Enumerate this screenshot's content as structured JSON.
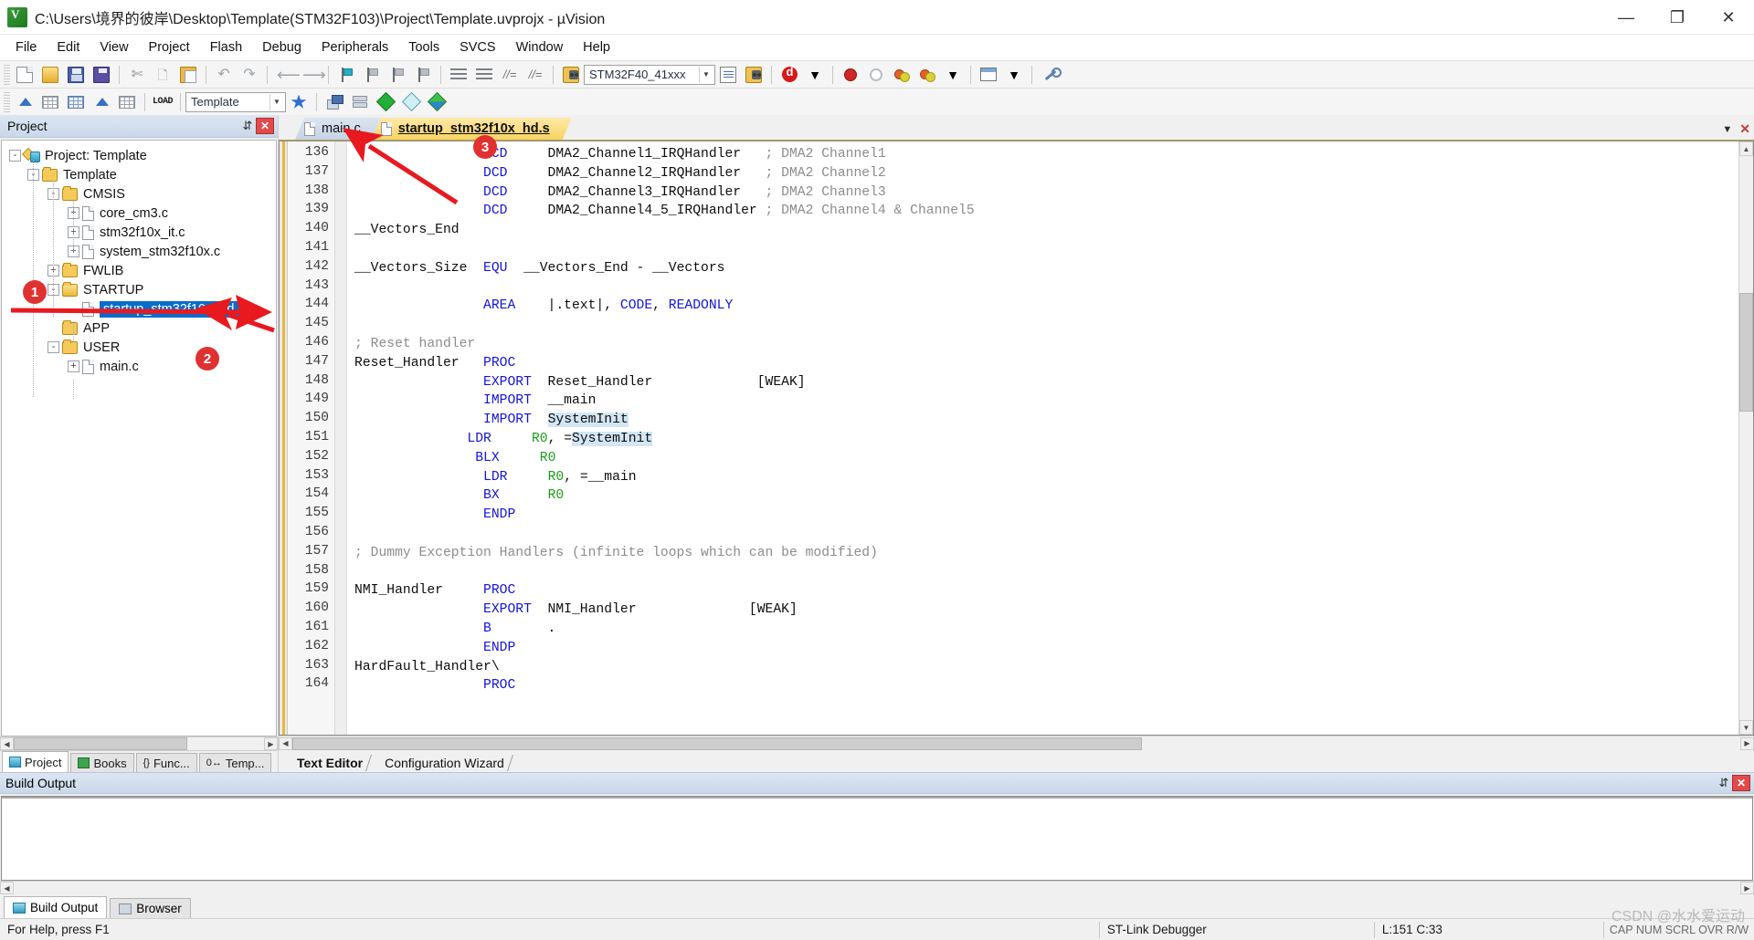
{
  "window": {
    "title": "C:\\Users\\境界的彼岸\\Desktop\\Template(STM32F103)\\Project\\Template.uvprojx - µVision",
    "app_icon": "uvision-icon",
    "minimize": "—",
    "maximize": "❐",
    "close": "✕"
  },
  "menu": [
    {
      "label": "File"
    },
    {
      "label": "Edit"
    },
    {
      "label": "View"
    },
    {
      "label": "Project"
    },
    {
      "label": "Flash"
    },
    {
      "label": "Debug"
    },
    {
      "label": "Peripherals"
    },
    {
      "label": "Tools"
    },
    {
      "label": "SVCS"
    },
    {
      "label": "Window"
    },
    {
      "label": "Help"
    }
  ],
  "toolbar": {
    "target_value": "STM32F40_41xxx",
    "project_value": "Template",
    "load_label": "LOAD"
  },
  "project_panel": {
    "title": "Project",
    "pin_glyph": "⇵",
    "close_glyph": "✕",
    "tree": [
      {
        "label": "Project: Template",
        "level": 0,
        "icon": "project-icon",
        "expander": "-"
      },
      {
        "label": "Template",
        "level": 1,
        "icon": "folder-target-icon",
        "expander": "-"
      },
      {
        "label": "CMSIS",
        "level": 2,
        "icon": "folder-icon",
        "expander": "-"
      },
      {
        "label": "core_cm3.c",
        "level": 3,
        "icon": "file-icon",
        "expander": "+"
      },
      {
        "label": "stm32f10x_it.c",
        "level": 3,
        "icon": "file-icon",
        "expander": "+"
      },
      {
        "label": "system_stm32f10x.c",
        "level": 3,
        "icon": "file-icon",
        "expander": "+"
      },
      {
        "label": "FWLIB",
        "level": 2,
        "icon": "folder-icon",
        "expander": "+"
      },
      {
        "label": "STARTUP",
        "level": 2,
        "icon": "folder-open-icon",
        "expander": "-"
      },
      {
        "label": "startup_stm32f10x_hd.s",
        "level": 3,
        "icon": "file-icon",
        "expander": "",
        "selected": true
      },
      {
        "label": "APP",
        "level": 2,
        "icon": "folder-icon",
        "expander": ""
      },
      {
        "label": "USER",
        "level": 2,
        "icon": "folder-icon",
        "expander": "-"
      },
      {
        "label": "main.c",
        "level": 3,
        "icon": "file-icon",
        "expander": "+"
      }
    ],
    "tabs": [
      {
        "label": "Project",
        "icon": "project-tab-icon",
        "active": true
      },
      {
        "label": "Books",
        "icon": "books-tab-icon",
        "active": false
      },
      {
        "label": "Func...",
        "icon": "functions-tab-icon",
        "active": false
      },
      {
        "label": "Temp...",
        "icon": "templates-tab-icon",
        "active": false
      }
    ]
  },
  "editor": {
    "tabs": [
      {
        "label": "main.c",
        "active": false
      },
      {
        "label": "startup_stm32f10x_hd.s",
        "active": true
      }
    ],
    "first_line": 136,
    "lines": [
      {
        "n": 136,
        "segments": [
          {
            "t": "                ",
            "c": ""
          },
          {
            "t": "DCD",
            "c": "kw"
          },
          {
            "t": "     DMA2_Channel1_IRQHandler   ",
            "c": ""
          },
          {
            "t": "; DMA2 Channel1",
            "c": "cm"
          }
        ]
      },
      {
        "n": 137,
        "segments": [
          {
            "t": "                ",
            "c": ""
          },
          {
            "t": "DCD",
            "c": "kw"
          },
          {
            "t": "     DMA2_Channel2_IRQHandler   ",
            "c": ""
          },
          {
            "t": "; DMA2 Channel2",
            "c": "cm"
          }
        ]
      },
      {
        "n": 138,
        "segments": [
          {
            "t": "                ",
            "c": ""
          },
          {
            "t": "DCD",
            "c": "kw"
          },
          {
            "t": "     DMA2_Channel3_IRQHandler   ",
            "c": ""
          },
          {
            "t": "; DMA2 Channel3",
            "c": "cm"
          }
        ]
      },
      {
        "n": 139,
        "segments": [
          {
            "t": "                ",
            "c": ""
          },
          {
            "t": "DCD",
            "c": "kw"
          },
          {
            "t": "     DMA2_Channel4_5_IRQHandler ",
            "c": ""
          },
          {
            "t": "; DMA2 Channel4 & Channel5",
            "c": "cm"
          }
        ]
      },
      {
        "n": 140,
        "segments": [
          {
            "t": "__Vectors_End",
            "c": ""
          }
        ]
      },
      {
        "n": 141,
        "segments": [
          {
            "t": "",
            "c": ""
          }
        ]
      },
      {
        "n": 142,
        "segments": [
          {
            "t": "__Vectors_Size  ",
            "c": ""
          },
          {
            "t": "EQU",
            "c": "kw"
          },
          {
            "t": "  __Vectors_End - __Vectors",
            "c": ""
          }
        ]
      },
      {
        "n": 143,
        "segments": [
          {
            "t": "",
            "c": ""
          }
        ]
      },
      {
        "n": 144,
        "segments": [
          {
            "t": "                ",
            "c": ""
          },
          {
            "t": "AREA",
            "c": "kw"
          },
          {
            "t": "    |.text|, ",
            "c": ""
          },
          {
            "t": "CODE",
            "c": "kw"
          },
          {
            "t": ", ",
            "c": ""
          },
          {
            "t": "READONLY",
            "c": "kw"
          }
        ]
      },
      {
        "n": 145,
        "segments": [
          {
            "t": "",
            "c": ""
          }
        ]
      },
      {
        "n": 146,
        "segments": [
          {
            "t": "; Reset handler",
            "c": "cm"
          }
        ]
      },
      {
        "n": 147,
        "segments": [
          {
            "t": "Reset_Handler   ",
            "c": ""
          },
          {
            "t": "PROC",
            "c": "kw"
          }
        ]
      },
      {
        "n": 148,
        "segments": [
          {
            "t": "                ",
            "c": ""
          },
          {
            "t": "EXPORT",
            "c": "kw"
          },
          {
            "t": "  Reset_Handler             [WEAK]",
            "c": ""
          }
        ]
      },
      {
        "n": 149,
        "segments": [
          {
            "t": "                ",
            "c": ""
          },
          {
            "t": "IMPORT",
            "c": "kw"
          },
          {
            "t": "  __main",
            "c": ""
          }
        ]
      },
      {
        "n": 150,
        "segments": [
          {
            "t": "                ",
            "c": ""
          },
          {
            "t": "IMPORT",
            "c": "kw"
          },
          {
            "t": "  ",
            "c": ""
          },
          {
            "t": "SystemInit",
            "c": "hl"
          }
        ]
      },
      {
        "n": 151,
        "segments": [
          {
            "t": "              ",
            "c": ""
          },
          {
            "t": "LDR",
            "c": "kw"
          },
          {
            "t": "     ",
            "c": ""
          },
          {
            "t": "R0",
            "c": "reg"
          },
          {
            "t": ", =",
            "c": ""
          },
          {
            "t": "SystemInit",
            "c": "hl"
          }
        ]
      },
      {
        "n": 152,
        "segments": [
          {
            "t": "               ",
            "c": ""
          },
          {
            "t": "BLX",
            "c": "kw"
          },
          {
            "t": "     ",
            "c": ""
          },
          {
            "t": "R0",
            "c": "reg"
          }
        ]
      },
      {
        "n": 153,
        "segments": [
          {
            "t": "                ",
            "c": ""
          },
          {
            "t": "LDR",
            "c": "kw"
          },
          {
            "t": "     ",
            "c": ""
          },
          {
            "t": "R0",
            "c": "reg"
          },
          {
            "t": ", =__main",
            "c": ""
          }
        ]
      },
      {
        "n": 154,
        "segments": [
          {
            "t": "                ",
            "c": ""
          },
          {
            "t": "BX",
            "c": "kw"
          },
          {
            "t": "      ",
            "c": ""
          },
          {
            "t": "R0",
            "c": "reg"
          }
        ]
      },
      {
        "n": 155,
        "segments": [
          {
            "t": "                ",
            "c": ""
          },
          {
            "t": "ENDP",
            "c": "kw"
          }
        ]
      },
      {
        "n": 156,
        "segments": [
          {
            "t": "",
            "c": ""
          }
        ]
      },
      {
        "n": 157,
        "segments": [
          {
            "t": "; Dummy Exception Handlers (infinite loops which can be modified)",
            "c": "cm"
          }
        ]
      },
      {
        "n": 158,
        "segments": [
          {
            "t": "",
            "c": ""
          }
        ]
      },
      {
        "n": 159,
        "segments": [
          {
            "t": "NMI_Handler     ",
            "c": ""
          },
          {
            "t": "PROC",
            "c": "kw"
          }
        ]
      },
      {
        "n": 160,
        "segments": [
          {
            "t": "                ",
            "c": ""
          },
          {
            "t": "EXPORT",
            "c": "kw"
          },
          {
            "t": "  NMI_Handler              [WEAK]",
            "c": ""
          }
        ]
      },
      {
        "n": 161,
        "segments": [
          {
            "t": "                ",
            "c": ""
          },
          {
            "t": "B",
            "c": "kw"
          },
          {
            "t": "       .",
            "c": ""
          }
        ]
      },
      {
        "n": 162,
        "segments": [
          {
            "t": "                ",
            "c": ""
          },
          {
            "t": "ENDP",
            "c": "kw"
          }
        ]
      },
      {
        "n": 163,
        "segments": [
          {
            "t": "HardFault_Handler\\",
            "c": ""
          }
        ]
      },
      {
        "n": 164,
        "segments": [
          {
            "t": "                ",
            "c": ""
          },
          {
            "t": "PROC",
            "c": "kw"
          }
        ]
      }
    ],
    "bottom_tabs": [
      {
        "label": "Text Editor",
        "active": true
      },
      {
        "label": "Configuration Wizard",
        "active": false
      }
    ]
  },
  "build_output": {
    "title": "Build Output",
    "pin_glyph": "⇵",
    "close_glyph": "✕",
    "content": "",
    "tabs": [
      {
        "label": "Build Output",
        "icon": "build-output-icon",
        "active": true
      },
      {
        "label": "Browser",
        "icon": "browser-icon",
        "active": false
      }
    ]
  },
  "status_bar": {
    "help_text": "For Help, press F1",
    "debugger": "ST-Link Debugger",
    "cursor_position": "L:151 C:33",
    "indicators": "CAP NUM SCRL OVR R/W"
  },
  "annotations": [
    {
      "number": "1",
      "target": "startup-folder"
    },
    {
      "number": "2",
      "target": "startup-file"
    },
    {
      "number": "3",
      "target": "editor-tab"
    }
  ],
  "watermark": {
    "line1": "CSDN @水水爱运动"
  },
  "colors": {
    "accent_blue": "#0a6ccc",
    "tab_active": "#f8d461",
    "annotation_red": "#e03131",
    "keyword_blue": "#1414d6",
    "comment_gray": "#8c8c8c",
    "register_green": "#1a9e1a"
  }
}
